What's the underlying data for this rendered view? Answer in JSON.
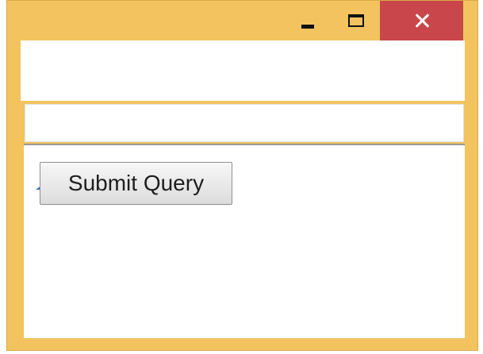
{
  "window": {
    "frame_color": "#f2c35f",
    "close_color": "#c9474a",
    "controls": {
      "minimize_icon": "minimize-icon",
      "maximize_icon": "maximize-icon",
      "close_icon": "close-icon"
    }
  },
  "address_field": {
    "value": "",
    "placeholder": ""
  },
  "form": {
    "submit_label": "Submit Query"
  }
}
